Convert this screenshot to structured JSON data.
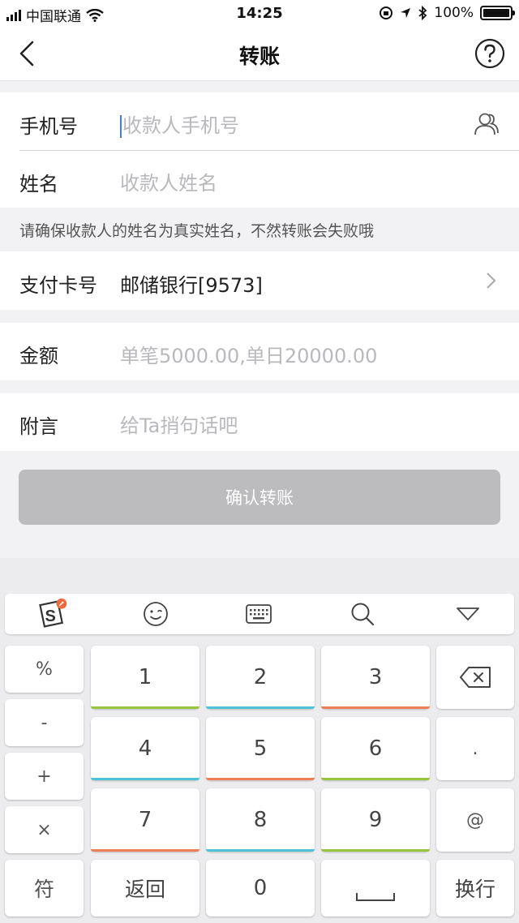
{
  "status_bar": {
    "carrier": "中国联通",
    "time": "14:25",
    "battery": "100%"
  },
  "nav": {
    "title": "转账",
    "back_icon": "chevron-left-icon",
    "help_icon": "question-circle-icon"
  },
  "form": {
    "phone_label": "手机号",
    "phone_placeholder": "收款人手机号",
    "name_label": "姓名",
    "name_placeholder": "收款人姓名",
    "hint": "请确保收款人的姓名为真实姓名，不然转账会失败哦",
    "card_label": "支付卡号",
    "card_value": "邮储银行[9573]",
    "amount_label": "金额",
    "amount_placeholder": "单笔5000.00,单日20000.00",
    "note_label": "附言",
    "note_placeholder": "给Ta捎句话吧",
    "confirm_label": "确认转账"
  },
  "keyboard": {
    "toolbar_icons": [
      "sogou-logo-icon",
      "emoji-icon",
      "keyboard-icon",
      "search-icon",
      "collapse-icon"
    ],
    "side_keys": [
      "%",
      "-",
      "+",
      "×",
      "符"
    ],
    "digits": [
      "1",
      "2",
      "3",
      "4",
      "5",
      "6",
      "7",
      "8",
      "9"
    ],
    "zero": "0",
    "return_label": "返回",
    "dot": ".",
    "at": "@",
    "newline_label": "换行"
  },
  "colors": {
    "green": "#9bc53d",
    "teal": "#4cc3d9",
    "orange": "#ef7d5a",
    "button_disabled": "#bcbcbf",
    "cursor": "#4a7bd0"
  }
}
